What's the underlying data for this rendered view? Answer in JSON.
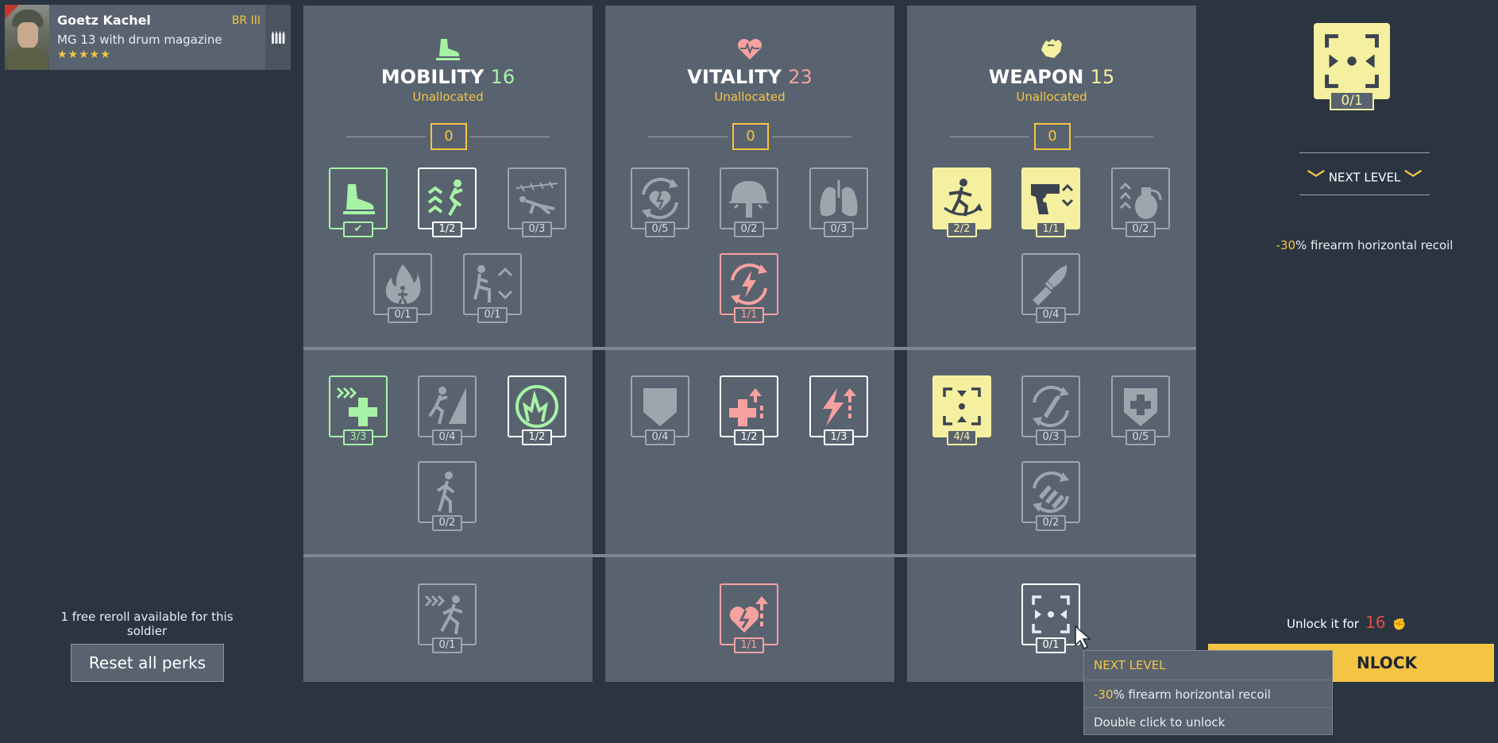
{
  "soldier": {
    "name": "Goetz Kachel",
    "rank": "BR III",
    "weapon": "MG 13 with drum magazine",
    "stars": "★★★★★"
  },
  "columns": {
    "mobility": {
      "title": "MOBILITY",
      "value": "16",
      "unallocated_label": "Unallocated",
      "unallocated": "0",
      "color": "#a6f3a6"
    },
    "vitality": {
      "title": "VITALITY",
      "value": "23",
      "unallocated_label": "Unallocated",
      "unallocated": "0",
      "color": "#f7a1a1"
    },
    "weapon": {
      "title": "WEAPON",
      "value": "15",
      "unallocated_label": "Unallocated",
      "unallocated": "0",
      "color": "#f5f0a0"
    }
  },
  "perks": {
    "m1": "✔",
    "m2": "1/2",
    "m3": "0/3",
    "m4": "0/1",
    "m5": "0/1",
    "m6": "3/3",
    "m7": "0/4",
    "m8": "1/2",
    "m9": "0/2",
    "m10": "0/1",
    "v1": "0/5",
    "v2": "0/2",
    "v3": "0/3",
    "v4": "1/1",
    "v5": "0/4",
    "v6": "1/2",
    "v7": "1/3",
    "v8": "1/1",
    "w1": "2/2",
    "w2": "1/1",
    "w3": "0/2",
    "w4": "0/4",
    "w5": "4/4",
    "w6": "0/3",
    "w7": "0/5",
    "w8": "0/2",
    "w9": "0/1"
  },
  "left_panel": {
    "reroll_text": "1 free reroll available for this soldier",
    "reset_button": "Reset all perks"
  },
  "right_panel": {
    "perk_count": "0/1",
    "next_level": "NEXT LEVEL",
    "desc_value": "-30",
    "desc_text": "% firearm horizontal recoil",
    "unlock_text": "Unlock it for",
    "unlock_cost": "16",
    "unlock_button": "NLOCK"
  },
  "tooltip": {
    "title": "NEXT LEVEL",
    "desc_value": "-30",
    "desc_text": "% firearm horizontal recoil",
    "hint": "Double click to unlock"
  },
  "colors": {
    "background": "#2b3542",
    "panel": "#59636f",
    "accent": "#f4c542",
    "mobility": "#a6f3a6",
    "vitality": "#f7a1a1",
    "weapon": "#f5f0a0",
    "cost": "#e74c3c"
  }
}
